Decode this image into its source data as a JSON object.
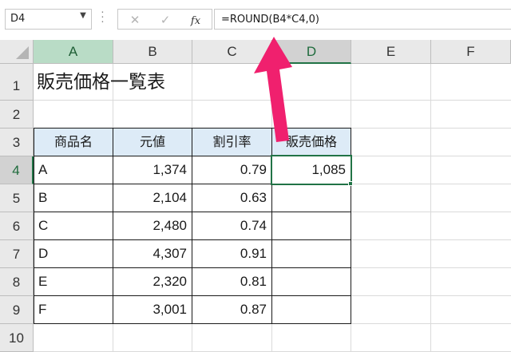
{
  "formula_bar": {
    "name_box": "D4",
    "cancel_icon": "✕",
    "enter_icon": "✓",
    "fx_label": "fx",
    "formula": "=ROUND(B4*C4,0)"
  },
  "columns": [
    "A",
    "B",
    "C",
    "D",
    "E",
    "F"
  ],
  "rows": [
    "1",
    "2",
    "3",
    "4",
    "5",
    "6",
    "7",
    "8",
    "9",
    "10"
  ],
  "sheet": {
    "title": "販売価格一覧表",
    "table_headers": [
      "商品名",
      "元値",
      "割引率",
      "販売価格"
    ],
    "table_rows": [
      {
        "name": "A",
        "price": "1,374",
        "rate": "0.79",
        "sale": "1,085"
      },
      {
        "name": "B",
        "price": "2,104",
        "rate": "0.63",
        "sale": ""
      },
      {
        "name": "C",
        "price": "2,480",
        "rate": "0.74",
        "sale": ""
      },
      {
        "name": "D",
        "price": "4,307",
        "rate": "0.91",
        "sale": ""
      },
      {
        "name": "E",
        "price": "2,320",
        "rate": "0.81",
        "sale": ""
      },
      {
        "name": "F",
        "price": "3,001",
        "rate": "0.87",
        "sale": ""
      }
    ]
  },
  "colors": {
    "excel_green": "#217346",
    "header_fill": "#ddebf7",
    "arrow_pink": "#f0206e"
  },
  "icons": [
    "dropdown-icon",
    "more-dots-icon",
    "cancel-icon",
    "enter-icon",
    "function-icon",
    "select-all-icon",
    "pointer-arrow-icon"
  ]
}
